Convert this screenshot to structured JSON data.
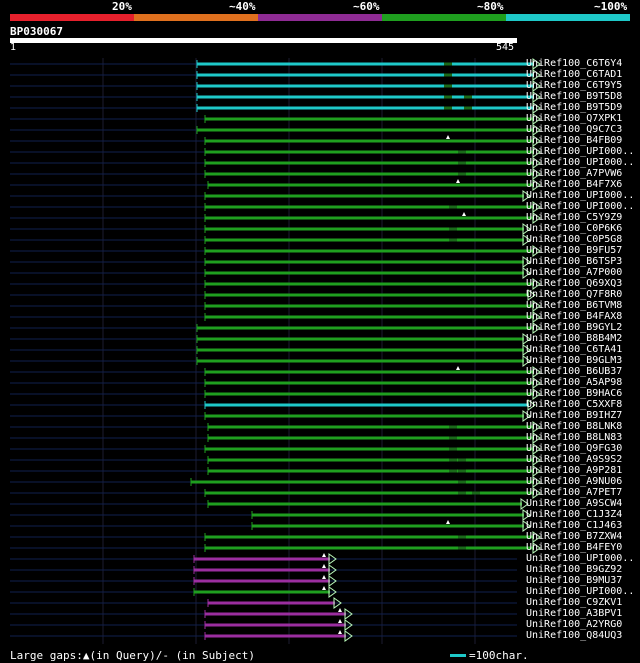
{
  "scale": {
    "labels": [
      "20%",
      "~40%",
      "~60%",
      "~80%",
      "~100%"
    ],
    "colors": [
      "#e6202c",
      "#e0701e",
      "#8f2b94",
      "#1f9f1f",
      "#1ec8c8"
    ]
  },
  "query": {
    "title": "BP030067",
    "start": "1",
    "end": "545",
    "length": 545
  },
  "hit_colors": {
    "cyan": "#1ec8c8",
    "green": "#1f9f1f",
    "magenta": "#9b2ea0",
    "dim": "#10204e",
    "arrow": "#b8f7b8"
  },
  "hits": [
    {
      "label": "UniRef100_C6T6Y4",
      "color": "cyan",
      "start": 197,
      "end": 540,
      "marks": [
        {
          "type": "bar",
          "at": 448
        }
      ]
    },
    {
      "label": "UniRef100_C6TAD1",
      "color": "cyan",
      "start": 197,
      "end": 540,
      "marks": [
        {
          "type": "bar",
          "at": 448
        }
      ]
    },
    {
      "label": "UniRef100_C6T9Y5",
      "color": "cyan",
      "start": 197,
      "end": 540,
      "marks": [
        {
          "type": "bar",
          "at": 448
        }
      ]
    },
    {
      "label": "UniRef100_B9T5D8",
      "color": "cyan",
      "start": 197,
      "end": 540,
      "marks": [
        {
          "type": "bar",
          "at": 448
        },
        {
          "type": "bar",
          "at": 468
        }
      ]
    },
    {
      "label": "UniRef100_B9T5D9",
      "color": "cyan",
      "start": 197,
      "end": 540,
      "marks": [
        {
          "type": "bar",
          "at": 448
        },
        {
          "type": "bar",
          "at": 468
        }
      ]
    },
    {
      "label": "UniRef100_Q7XPK1",
      "color": "green",
      "start": 205,
      "end": 540,
      "marks": []
    },
    {
      "label": "UniRef100_Q9C7C3",
      "color": "green",
      "start": 197,
      "end": 540,
      "marks": []
    },
    {
      "label": "UniRef100_B4FB09",
      "color": "green",
      "start": 205,
      "end": 540,
      "marks": [
        {
          "type": "tri",
          "at": 448
        }
      ]
    },
    {
      "label": "UniRef100_UPI000..",
      "color": "green",
      "start": 205,
      "end": 540,
      "marks": [
        {
          "type": "bar",
          "at": 462
        }
      ]
    },
    {
      "label": "UniRef100_UPI000..",
      "color": "green",
      "start": 205,
      "end": 540,
      "marks": [
        {
          "type": "bar",
          "at": 462
        }
      ]
    },
    {
      "label": "UniRef100_A7PVW6",
      "color": "green",
      "start": 205,
      "end": 540,
      "marks": [
        {
          "type": "bar",
          "at": 462
        }
      ]
    },
    {
      "label": "UniRef100_B4F7X6",
      "color": "green",
      "start": 208,
      "end": 540,
      "marks": [
        {
          "type": "tri",
          "at": 458
        }
      ]
    },
    {
      "label": "UniRef100_UPI000..",
      "color": "green",
      "start": 205,
      "end": 530,
      "marks": []
    },
    {
      "label": "UniRef100_UPI000..",
      "color": "green",
      "start": 205,
      "end": 540,
      "marks": [
        {
          "type": "bar",
          "at": 453
        }
      ]
    },
    {
      "label": "UniRef100_C5Y9Z9",
      "color": "green",
      "start": 205,
      "end": 540,
      "marks": [
        {
          "type": "tri",
          "at": 464
        }
      ]
    },
    {
      "label": "UniRef100_C0P6K6",
      "color": "green",
      "start": 205,
      "end": 530,
      "marks": [
        {
          "type": "bar",
          "at": 453
        }
      ]
    },
    {
      "label": "UniRef100_C0P5G8",
      "color": "green",
      "start": 205,
      "end": 530,
      "marks": [
        {
          "type": "bar",
          "at": 453
        }
      ]
    },
    {
      "label": "UniRef100_B9FU57",
      "color": "green",
      "start": 205,
      "end": 540,
      "marks": []
    },
    {
      "label": "UniRef100_B6TSP3",
      "color": "green",
      "start": 205,
      "end": 530,
      "marks": []
    },
    {
      "label": "UniRef100_A7P000",
      "color": "green",
      "start": 205,
      "end": 530,
      "marks": []
    },
    {
      "label": "UniRef100_Q69XQ3",
      "color": "green",
      "start": 205,
      "end": 540,
      "marks": []
    },
    {
      "label": "UniRef100_Q7F8R0",
      "color": "green",
      "start": 205,
      "end": 535,
      "marks": []
    },
    {
      "label": "UniRef100_B6TVM8",
      "color": "green",
      "start": 205,
      "end": 540,
      "marks": []
    },
    {
      "label": "UniRef100_B4FAX8",
      "color": "green",
      "start": 205,
      "end": 540,
      "marks": []
    },
    {
      "label": "UniRef100_B9GYL2",
      "color": "green",
      "start": 197,
      "end": 540,
      "marks": []
    },
    {
      "label": "UniRef100_B8B4M2",
      "color": "green",
      "start": 197,
      "end": 530,
      "marks": []
    },
    {
      "label": "UniRef100_C6TA41",
      "color": "green",
      "start": 197,
      "end": 530,
      "marks": []
    },
    {
      "label": "UniRef100_B9GLM3",
      "color": "green",
      "start": 197,
      "end": 530,
      "marks": []
    },
    {
      "label": "UniRef100_B6UB37",
      "color": "green",
      "start": 205,
      "end": 540,
      "marks": [
        {
          "type": "tri",
          "at": 458
        }
      ]
    },
    {
      "label": "UniRef100_A5AP98",
      "color": "green",
      "start": 205,
      "end": 540,
      "marks": []
    },
    {
      "label": "UniRef100_B9HAC6",
      "color": "green",
      "start": 205,
      "end": 540,
      "marks": []
    },
    {
      "label": "UniRef100_C5XXF8",
      "color": "cyan",
      "start": 205,
      "end": 535,
      "marks": []
    },
    {
      "label": "UniRef100_B9IHZ7",
      "color": "green",
      "start": 205,
      "end": 530,
      "marks": []
    },
    {
      "label": "UniRef100_B8LNK8",
      "color": "green",
      "start": 208,
      "end": 540,
      "marks": [
        {
          "type": "bar",
          "at": 453
        }
      ]
    },
    {
      "label": "UniRef100_B8LN83",
      "color": "green",
      "start": 208,
      "end": 540,
      "marks": [
        {
          "type": "bar",
          "at": 453
        }
      ]
    },
    {
      "label": "UniRef100_Q9FG30",
      "color": "green",
      "start": 205,
      "end": 540,
      "marks": [
        {
          "type": "bar",
          "at": 453
        }
      ]
    },
    {
      "label": "UniRef100_A9S9S2",
      "color": "green",
      "start": 208,
      "end": 540,
      "marks": [
        {
          "type": "bar",
          "at": 453
        },
        {
          "type": "bar",
          "at": 462
        }
      ]
    },
    {
      "label": "UniRef100_A9P281",
      "color": "green",
      "start": 208,
      "end": 540,
      "marks": [
        {
          "type": "bar",
          "at": 453
        },
        {
          "type": "bar",
          "at": 462
        }
      ]
    },
    {
      "label": "UniRef100_A9NU06",
      "color": "green",
      "start": 191,
      "end": 540,
      "marks": [
        {
          "type": "bar",
          "at": 462
        }
      ]
    },
    {
      "label": "UniRef100_A7PET7",
      "color": "green",
      "start": 205,
      "end": 540,
      "marks": [
        {
          "type": "bar",
          "at": 462
        },
        {
          "type": "bar",
          "at": 476
        }
      ]
    },
    {
      "label": "UniRef100_A9SCW4",
      "color": "green",
      "start": 208,
      "end": 528,
      "marks": []
    },
    {
      "label": "UniRef100_C1J3Z4",
      "color": "green",
      "start": 252,
      "end": 530,
      "marks": []
    },
    {
      "label": "UniRef100_C1J463",
      "color": "green",
      "start": 252,
      "end": 530,
      "marks": [
        {
          "type": "tri",
          "at": 448
        }
      ]
    },
    {
      "label": "UniRef100_B7ZXW4",
      "color": "green",
      "start": 205,
      "end": 540,
      "marks": [
        {
          "type": "bar",
          "at": 462
        }
      ]
    },
    {
      "label": "UniRef100_B4FEY0",
      "color": "green",
      "start": 205,
      "end": 540,
      "marks": [
        {
          "type": "bar",
          "at": 462
        }
      ]
    },
    {
      "label": "UniRef100_UPI000..",
      "color": "magenta",
      "start": 194,
      "end": 336,
      "marks": [
        {
          "type": "tri",
          "at": 324
        }
      ]
    },
    {
      "label": "UniRef100_B9GZ92",
      "color": "magenta",
      "start": 194,
      "end": 336,
      "marks": [
        {
          "type": "tri",
          "at": 324
        }
      ]
    },
    {
      "label": "UniRef100_B9MU37",
      "color": "magenta",
      "start": 194,
      "end": 336,
      "marks": [
        {
          "type": "tri",
          "at": 324
        }
      ]
    },
    {
      "label": "UniRef100_UPI000..",
      "color": "green",
      "start": 194,
      "end": 336,
      "marks": [
        {
          "type": "tri",
          "at": 324
        }
      ]
    },
    {
      "label": "UniRef100_C9ZKV1",
      "color": "magenta",
      "start": 208,
      "end": 341,
      "marks": []
    },
    {
      "label": "UniRef100_A3BPV1",
      "color": "magenta",
      "start": 205,
      "end": 352,
      "marks": [
        {
          "type": "tri",
          "at": 340
        }
      ]
    },
    {
      "label": "UniRef100_A2YRG0",
      "color": "magenta",
      "start": 205,
      "end": 352,
      "marks": [
        {
          "type": "tri",
          "at": 340
        }
      ]
    },
    {
      "label": "UniRef100_Q84UQ3",
      "color": "magenta",
      "start": 205,
      "end": 352,
      "marks": [
        {
          "type": "tri",
          "at": 340
        }
      ]
    }
  ],
  "footer": {
    "gaps_legend": "Large gaps:▲(in Query)/- (in Subject)",
    "scale_legend": "=100char."
  }
}
